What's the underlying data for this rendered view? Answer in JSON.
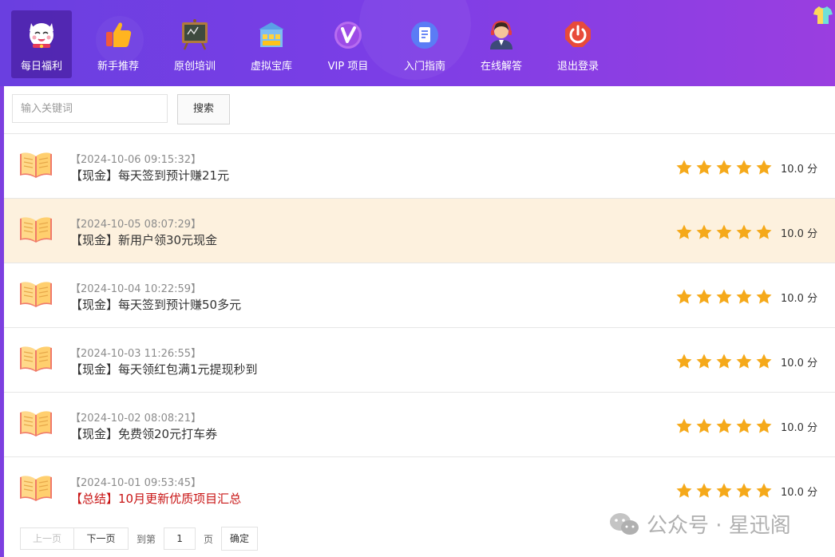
{
  "nav": {
    "items": [
      {
        "label": "每日福利",
        "icon": "lucky-cat-icon",
        "active": true
      },
      {
        "label": "新手推荐",
        "icon": "thumbs-up-icon",
        "active": false
      },
      {
        "label": "原创培训",
        "icon": "blackboard-icon",
        "active": false
      },
      {
        "label": "虚拟宝库",
        "icon": "treasure-store-icon",
        "active": false
      },
      {
        "label": "VIP 项目",
        "icon": "vip-icon",
        "active": false
      },
      {
        "label": "入门指南",
        "icon": "guide-icon",
        "active": false
      },
      {
        "label": "在线解答",
        "icon": "support-agent-icon",
        "active": false
      },
      {
        "label": "退出登录",
        "icon": "power-icon",
        "active": false
      }
    ],
    "skin_icon": "tshirt-icon"
  },
  "search": {
    "placeholder": "输入关键词",
    "button_label": "搜索"
  },
  "list": [
    {
      "date": "【2024-10-06 09:15:32】",
      "title": "【现金】每天签到预计赚21元",
      "rating": 5,
      "score": "10.0 分",
      "highlight": false,
      "red": false
    },
    {
      "date": "【2024-10-05 08:07:29】",
      "title": "【现金】新用户领30元现金",
      "rating": 5,
      "score": "10.0 分",
      "highlight": true,
      "red": false
    },
    {
      "date": "【2024-10-04 10:22:59】",
      "title": "【现金】每天签到预计赚50多元",
      "rating": 5,
      "score": "10.0 分",
      "highlight": false,
      "red": false
    },
    {
      "date": "【2024-10-03 11:26:55】",
      "title": "【现金】每天领红包满1元提现秒到",
      "rating": 5,
      "score": "10.0 分",
      "highlight": false,
      "red": false
    },
    {
      "date": "【2024-10-02 08:08:21】",
      "title": "【现金】免费领20元打车券",
      "rating": 5,
      "score": "10.0 分",
      "highlight": false,
      "red": false
    },
    {
      "date": "【2024-10-01 09:53:45】",
      "title": "【总结】10月更新优质项目汇总",
      "rating": 5,
      "score": "10.0 分",
      "highlight": false,
      "red": true
    }
  ],
  "pager": {
    "prev": "上一页",
    "next": "下一页",
    "goto": "到第",
    "page_value": "1",
    "page_unit": "页",
    "confirm": "确定"
  },
  "watermark": {
    "text": "公众号 · 星迅阁",
    "icon": "wechat-icon"
  },
  "colors": {
    "header_start": "#6a3fe0",
    "header_end": "#9a3ee0",
    "star": "#f5a91a",
    "highlight_row": "#fdf1de",
    "red_title": "#c81414"
  }
}
